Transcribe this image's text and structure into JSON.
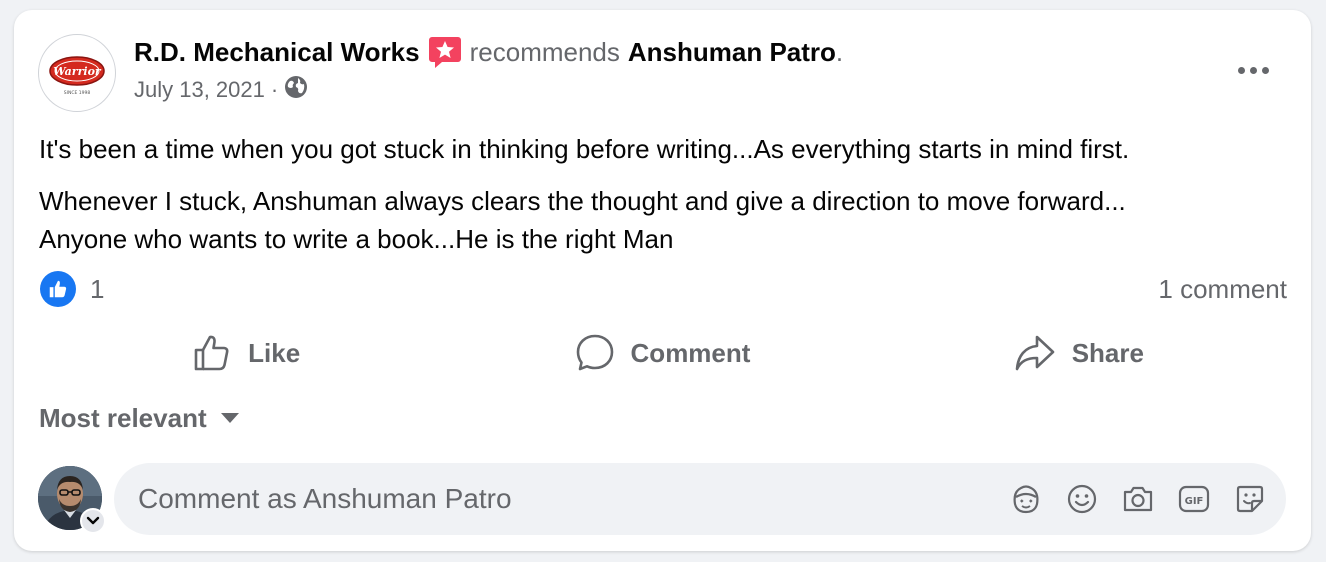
{
  "post": {
    "author": "R.D. Mechanical Works",
    "verb": "recommends",
    "target": "Anshuman Patro",
    "target_suffix": ".",
    "date": "July 13, 2021",
    "date_separator": "·",
    "privacy_icon": "globe-icon",
    "logo_text": "Warrior",
    "logo_subtext": "SINCE 1998",
    "paragraphs": [
      "It's been a time when you got stuck in thinking before writing...As everything starts in mind first.",
      "Whenever I stuck, Anshuman always clears the thought and give a direction to move forward...\nAnyone who wants to write a book...He is the right Man"
    ]
  },
  "stats": {
    "reaction_icon": "like-reaction-icon",
    "reaction_count": "1",
    "comment_count": "1 comment"
  },
  "actions": [
    {
      "label": "Like",
      "icon": "thumbs-up-icon"
    },
    {
      "label": "Comment",
      "icon": "comment-bubble-icon"
    },
    {
      "label": "Share",
      "icon": "share-arrow-icon"
    }
  ],
  "comments": {
    "sort_label": "Most relevant",
    "input_placeholder": "Comment as Anshuman Patro",
    "input_icons": [
      "avatar-sticker-icon",
      "emoji-icon",
      "camera-icon",
      "gif-icon",
      "sticker-icon"
    ]
  },
  "colors": {
    "accent": "#1877f2",
    "secondary_text": "#65676b",
    "recommend_badge": "#f3425f"
  }
}
